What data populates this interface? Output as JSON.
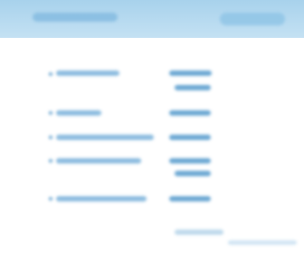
{
  "header": {
    "title": "",
    "action_label": ""
  },
  "items": [
    {
      "label": "",
      "price": ""
    },
    {
      "label": "",
      "price": ""
    },
    {
      "label": "",
      "price": ""
    },
    {
      "label": "",
      "price": ""
    },
    {
      "label": "",
      "price": ""
    }
  ],
  "footer": {
    "note": "",
    "link": ""
  },
  "colors": {
    "header_bg": "#b6daf0",
    "accent": "#5d9fcf",
    "background": "#ffffff"
  }
}
